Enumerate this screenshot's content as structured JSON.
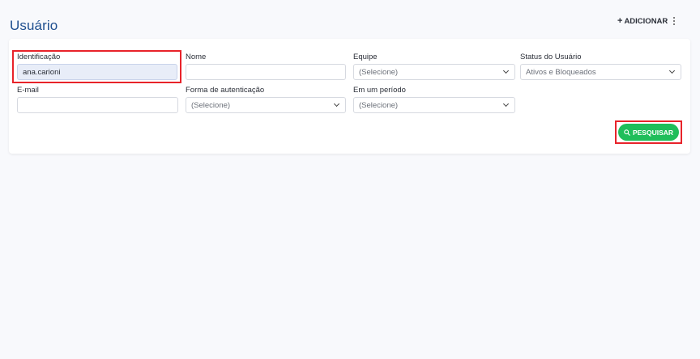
{
  "header": {
    "title": "Usuário",
    "add_label": "ADICIONAR",
    "add_icon": "plus-icon",
    "more_icon": "kebab-menu-icon"
  },
  "filters": {
    "identificacao": {
      "label": "Identificação",
      "value": "ana.carioni"
    },
    "nome": {
      "label": "Nome",
      "value": ""
    },
    "equipe": {
      "label": "Equipe",
      "value": "(Selecione)"
    },
    "status": {
      "label": "Status do Usuário",
      "value": "Ativos e Bloqueados"
    },
    "email": {
      "label": "E-mail",
      "value": ""
    },
    "autenticacao": {
      "label": "Forma de autenticação",
      "value": "(Selecione)"
    },
    "periodo": {
      "label": "Em um período",
      "value": "(Selecione)"
    }
  },
  "actions": {
    "search_label": "PESQUISAR",
    "search_icon": "search-icon"
  },
  "colors": {
    "title": "#1f4f8f",
    "search_button": "#1fbe5a",
    "highlight": "#e8232a",
    "filled_input": "#e8edf8"
  }
}
